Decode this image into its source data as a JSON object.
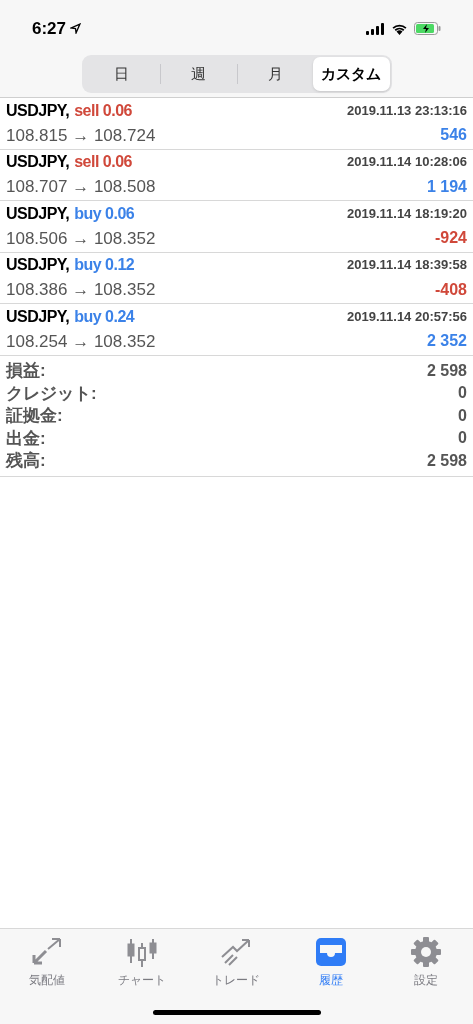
{
  "status_bar": {
    "time": "6:27"
  },
  "period_tabs": [
    {
      "label": "日",
      "selected": false
    },
    {
      "label": "週",
      "selected": false
    },
    {
      "label": "月",
      "selected": false
    },
    {
      "label": "カスタム",
      "selected": true
    }
  ],
  "trades": [
    {
      "symbol": "USDJPY,",
      "kind": "sell",
      "order": "sell 0.06",
      "time": "2019.11.13 23:13:16",
      "prices": "108.815 → 108.724",
      "profit": "546",
      "color": "#3b82e8"
    },
    {
      "symbol": "USDJPY,",
      "kind": "sell",
      "order": "sell 0.06",
      "time": "2019.11.14 10:28:06",
      "prices": "108.707 → 108.508",
      "profit": "1 194",
      "color": "#3b82e8"
    },
    {
      "symbol": "USDJPY,",
      "kind": "buy",
      "order": "buy 0.06",
      "time": "2019.11.14 18:19:20",
      "prices": "108.506 → 108.352",
      "profit": "-924",
      "color": "#d0483a"
    },
    {
      "symbol": "USDJPY,",
      "kind": "buy",
      "order": "buy 0.12",
      "time": "2019.11.14 18:39:58",
      "prices": "108.386 → 108.352",
      "profit": "-408",
      "color": "#d0483a"
    },
    {
      "symbol": "USDJPY,",
      "kind": "buy",
      "order": "buy 0.24",
      "time": "2019.11.14 20:57:56",
      "prices": "108.254 → 108.352",
      "profit": "2 352",
      "color": "#3b82e8"
    }
  ],
  "summary": [
    {
      "label": "損益:",
      "value": "2 598"
    },
    {
      "label": "クレジット:",
      "value": "0"
    },
    {
      "label": "証拠金:",
      "value": "0"
    },
    {
      "label": "出金:",
      "value": "0"
    },
    {
      "label": "残高:",
      "value": "2 598"
    }
  ],
  "tab_bar": [
    {
      "label": "気配値",
      "kind": "quotes",
      "selected": false
    },
    {
      "label": "チャート",
      "kind": "chart",
      "selected": false
    },
    {
      "label": "トレード",
      "kind": "trade",
      "selected": false
    },
    {
      "label": "履歴",
      "kind": "history",
      "selected": true
    },
    {
      "label": "設定",
      "kind": "settings",
      "selected": false
    }
  ]
}
